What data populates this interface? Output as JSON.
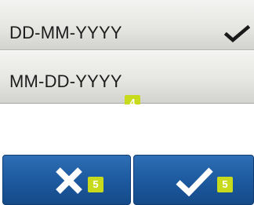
{
  "options": [
    {
      "label": "DD-MM-YYYY",
      "selected": true
    },
    {
      "label": "MM-DD-YYYY",
      "selected": false
    }
  ],
  "callouts": {
    "option_list": "4",
    "cancel": "5",
    "confirm": "5"
  },
  "buttons": {
    "cancel_icon": "close-icon",
    "confirm_icon": "check-icon"
  },
  "colors": {
    "button_blue": "#1d5aa0",
    "callout_yellow": "#c8da1c"
  }
}
